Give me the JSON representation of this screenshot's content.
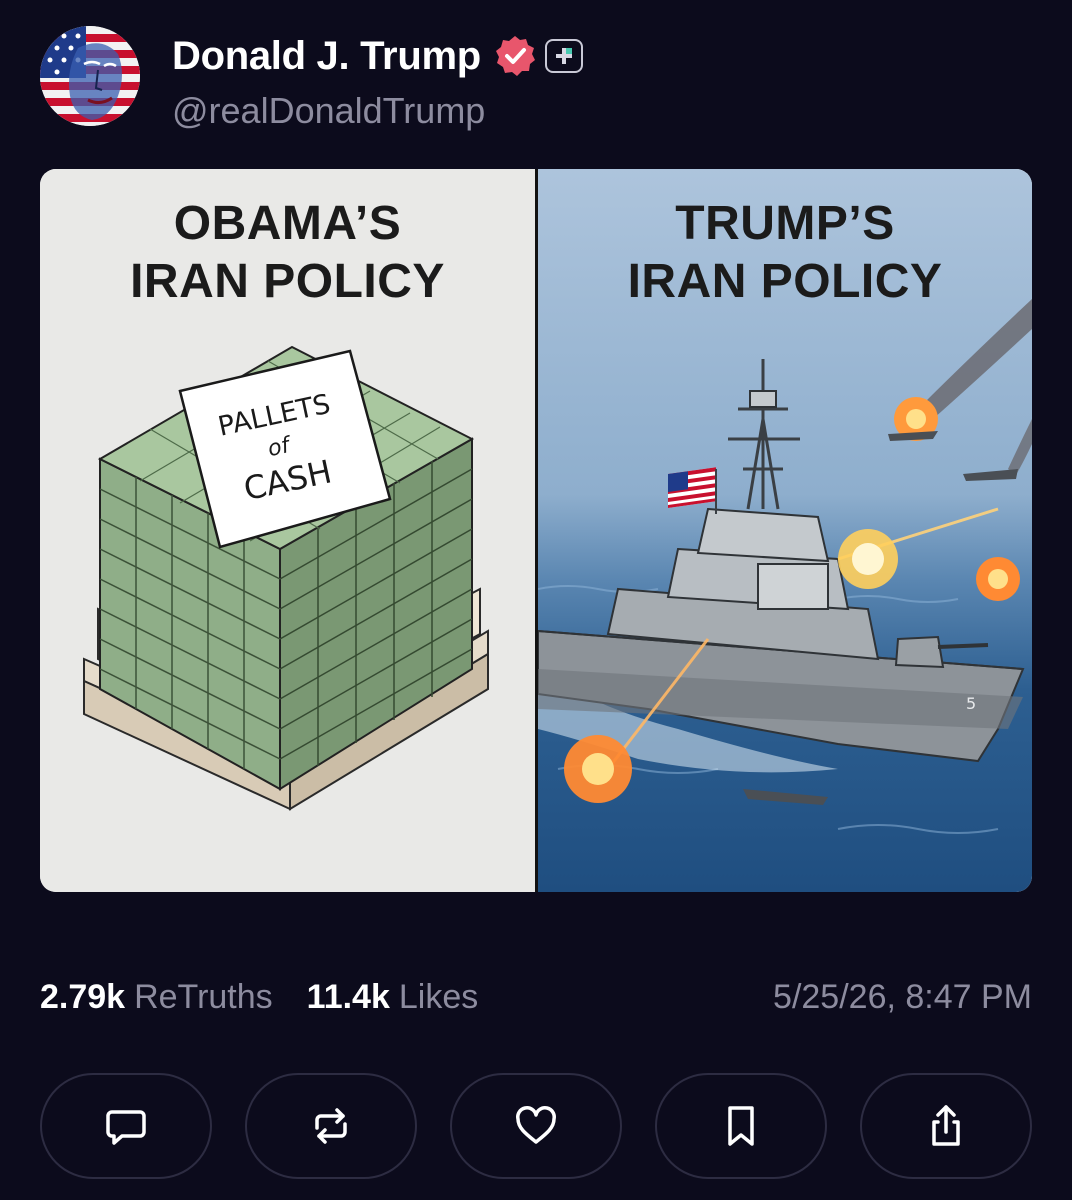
{
  "post": {
    "author": {
      "display_name": "Donald J. Trump",
      "handle": "@realDonaldTrump",
      "avatar_icon": "avatar-portrait-flag",
      "verified_icon": "verified-badge-icon",
      "verified_color": "#e8566c",
      "plus_icon": "plus-badge-icon"
    },
    "media": {
      "left_panel": {
        "title_line1": "OBAMA’S",
        "title_line2": "IRAN POLICY",
        "sign_line1": "PALLETS",
        "sign_line2": "of",
        "sign_line3": "CASH"
      },
      "right_panel": {
        "title_line1": "TRUMP’S",
        "title_line2": "IRAN POLICY",
        "hull_number": "5"
      }
    },
    "stats": {
      "retruths_count": "2.79k",
      "retruths_label": "ReTruths",
      "likes_count": "11.4k",
      "likes_label": "Likes",
      "timestamp": "5/25/26, 8:47 PM"
    },
    "actions": [
      {
        "icon": "reply-icon"
      },
      {
        "icon": "retruth-icon"
      },
      {
        "icon": "like-heart-icon"
      },
      {
        "icon": "bookmark-icon"
      },
      {
        "icon": "share-icon"
      }
    ]
  },
  "colors": {
    "background": "#0c0b1c",
    "muted_text": "#8d8c9f",
    "button_border": "#2d2c42"
  }
}
